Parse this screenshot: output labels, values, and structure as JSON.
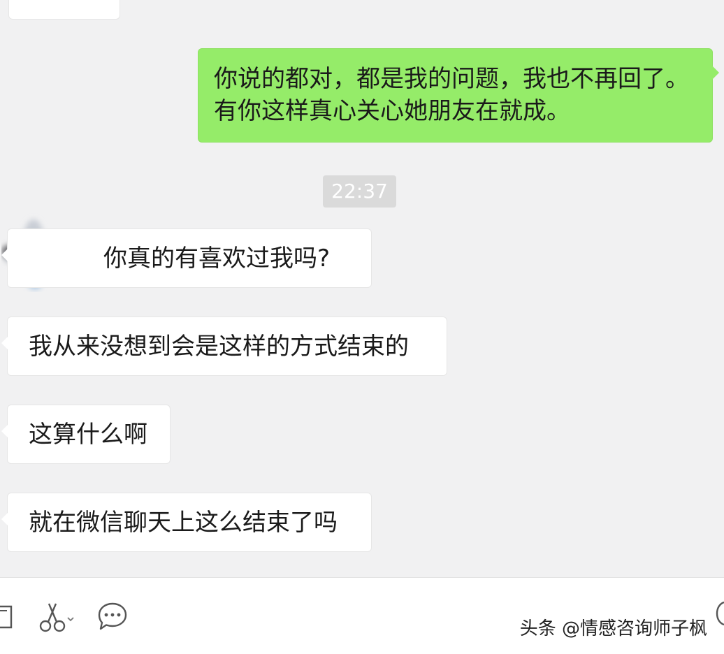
{
  "messages": [
    {
      "side": "out",
      "text": "你说的都对，都是我的问题，我也不再回了。有你这样真心关心她朋友在就成。"
    },
    {
      "side": "in",
      "text": "你真的有喜欢过我吗?"
    },
    {
      "side": "in",
      "text": "我从来没想到会是这样的方式结束的"
    },
    {
      "side": "in",
      "text": "这算什么啊"
    },
    {
      "side": "in",
      "text": "就在微信聊天上这么结束了吗"
    }
  ],
  "timestamp": "22:37",
  "toolbar": {
    "icons": [
      "file-icon",
      "scissors-icon",
      "chat-bubble-icon",
      "phone-icon"
    ]
  },
  "watermark": "头条 @情感咨询师子枫",
  "colors": {
    "background": "#f1f1f2",
    "outgoing_bubble": "#95ec69",
    "incoming_bubble": "#ffffff",
    "timestamp_bg": "#dadada"
  }
}
